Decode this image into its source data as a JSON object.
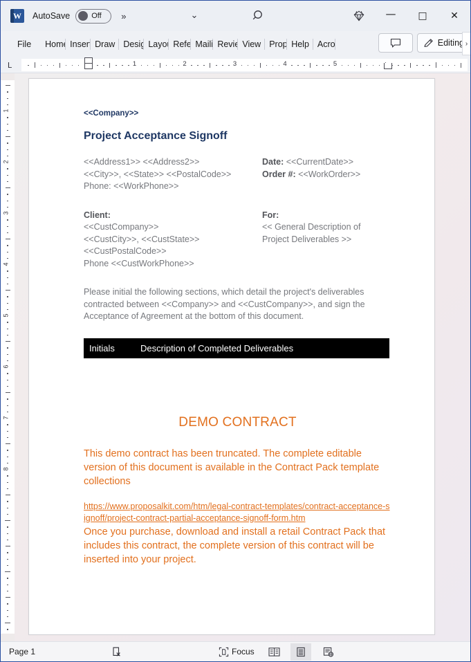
{
  "titlebar": {
    "app_icon": "word-icon",
    "app_icon_letter": "W",
    "autosave_label": "AutoSave",
    "autosave_state": "Off",
    "more_commands": "»",
    "customize_chevron": "⌄",
    "search_icon": "search-icon",
    "diamond_icon": "diamond-icon",
    "minimize": "—",
    "maximize": "□",
    "close": "✕"
  },
  "ribbon": {
    "tabs": [
      {
        "label": "File"
      },
      {
        "label": "Home"
      },
      {
        "label": "Insert"
      },
      {
        "label": "Draw"
      },
      {
        "label": "Design"
      },
      {
        "label": "Layout"
      },
      {
        "label": "References"
      },
      {
        "label": "Mailings"
      },
      {
        "label": "Review"
      },
      {
        "label": "View"
      },
      {
        "label": "Proposal Kit"
      },
      {
        "label": "Help"
      },
      {
        "label": "Acrobat"
      }
    ],
    "comment_button": "comment-icon",
    "editing_label": "Editing",
    "editing_icon": "pencil-icon",
    "overflow_chevron": "›"
  },
  "ruler": {
    "horizontal_numbers": [
      "1",
      "2",
      "3",
      "4",
      "5"
    ],
    "vertical_numbers": [
      "1",
      "2",
      "3",
      "4",
      "5",
      "6",
      "7",
      "8"
    ],
    "tab_stop_marker": "L"
  },
  "document": {
    "company": "<<Company>>",
    "title": "Project Acceptance Signoff",
    "address_lines": [
      "<<Address1>> <<Address2>>",
      "<<City>>, <<State>> <<PostalCode>>",
      "Phone: <<WorkPhone>>"
    ],
    "meta": [
      {
        "label": "Date:",
        "value": "<<CurrentDate>>"
      },
      {
        "label": "Order #:",
        "value": "<<WorkOrder>>"
      }
    ],
    "client_label": "Client:",
    "client_lines": [
      "<<CustCompany>>",
      "<<CustCity>>, <<CustState>>",
      "<<CustPostalCode>>",
      "Phone <<CustWorkPhone>>"
    ],
    "for_label": "For:",
    "for_lines": [
      "<< General Description of",
      "Project Deliverables >>"
    ],
    "intro_paragraph": "Please initial the following sections, which detail the project's deliverables contracted between <<Company>> and <<CustCompany>>, and sign the Acceptance of Agreement at the bottom of this document.",
    "table_header": {
      "col1": "Initials",
      "col2": "Description of Completed Deliverables"
    },
    "demo_title": "DEMO CONTRACT",
    "demo_paragraph": "This demo contract has been truncated. The complete editable version of this document is available in the Contract Pack template collections",
    "demo_link": "https://www.proposalkit.com/htm/legal-contract-templates/contract-acceptance-signoff/project-contract-partial-acceptance-signoff-form.htm",
    "demo_paragraph2": "Once you purchase, download and install a retail Contract Pack that includes this contract, the complete version of this contract will be inserted into your project."
  },
  "statusbar": {
    "page_indicator": "Page 1",
    "proofing_icon": "spelling-check-icon",
    "focus_label": "Focus",
    "focus_icon": "focus-icon",
    "view_read": "read-mode-icon",
    "view_print": "print-layout-icon",
    "view_web": "web-layout-icon"
  },
  "colors": {
    "word_blue": "#2b579a",
    "heading_navy": "#1f3864",
    "body_gray": "#76787d",
    "demo_orange": "#e2701e",
    "table_header_bg": "#000000",
    "window_border": "#2a4fa0"
  }
}
